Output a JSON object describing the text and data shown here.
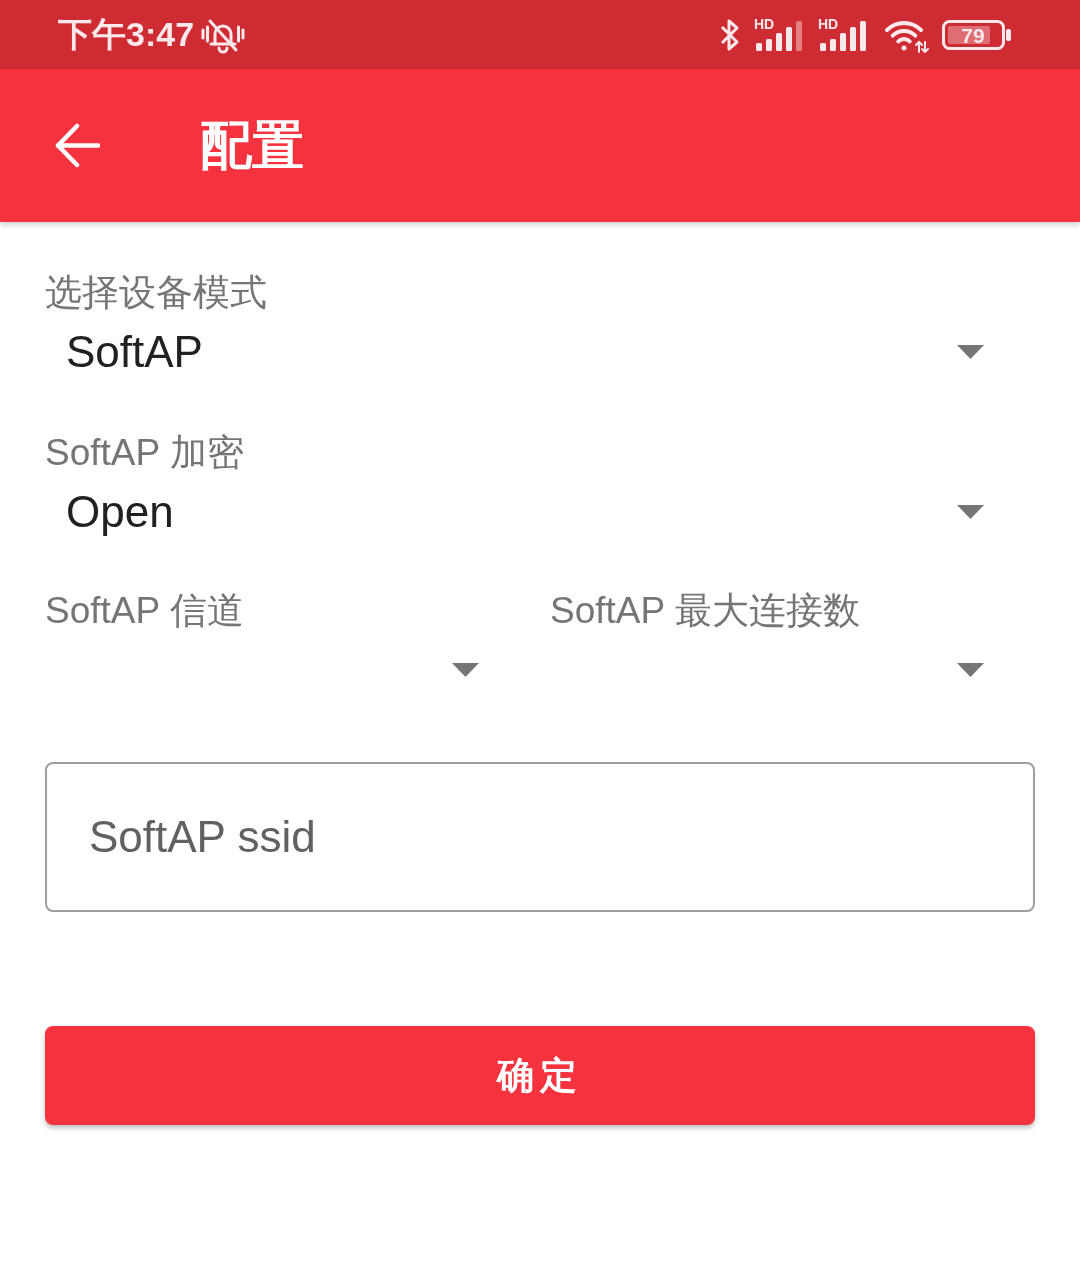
{
  "status_bar": {
    "time": "下午3:47",
    "signals": [
      {
        "type": "HD",
        "full": false
      },
      {
        "type": "HD",
        "full": true
      }
    ],
    "battery": "79"
  },
  "app_bar": {
    "title": "配置"
  },
  "spinners": [
    {
      "label": "选择设备模式",
      "value": "SoftAP"
    },
    {
      "label": "SoftAP 加密",
      "value": "Open"
    }
  ],
  "spinner_pair": [
    {
      "label": "SoftAP 信道"
    },
    {
      "label": "SoftAP 最大连接数"
    }
  ],
  "ssid_field": {
    "placeholder": "SoftAP ssid"
  },
  "confirm_button": {
    "label": "确定"
  }
}
